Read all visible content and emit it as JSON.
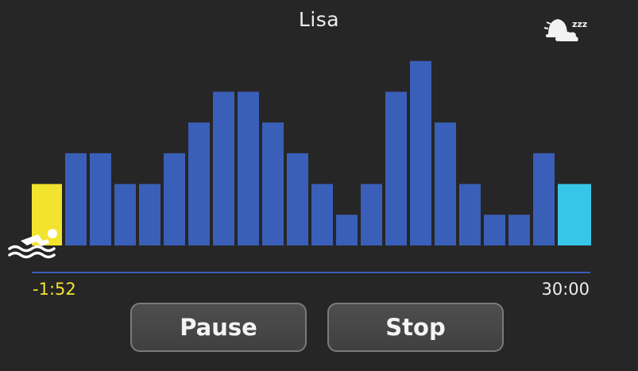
{
  "header": {
    "title": "Lisa"
  },
  "icons": {
    "sleep": "sleep-bell-zzz-icon",
    "swimmer": "swimmer-icon"
  },
  "timeline": {
    "start_label": "-1:52",
    "end_label": "30:00"
  },
  "controls": {
    "pause_label": "Pause",
    "stop_label": "Stop"
  },
  "colors": {
    "background": "#262626",
    "bar": "#3a5fb8",
    "current_bar": "#f2e32e",
    "last_bar": "#38c6e8",
    "axis": "#3a5fb8"
  },
  "chart_data": {
    "type": "bar",
    "values": [
      2,
      3,
      3,
      2,
      2,
      3,
      4,
      5,
      5,
      4,
      3,
      2,
      1,
      2,
      5,
      6,
      4,
      2,
      1,
      1,
      3,
      2
    ],
    "ylim": [
      0,
      6
    ],
    "highlight_first": true,
    "highlight_last": true
  }
}
